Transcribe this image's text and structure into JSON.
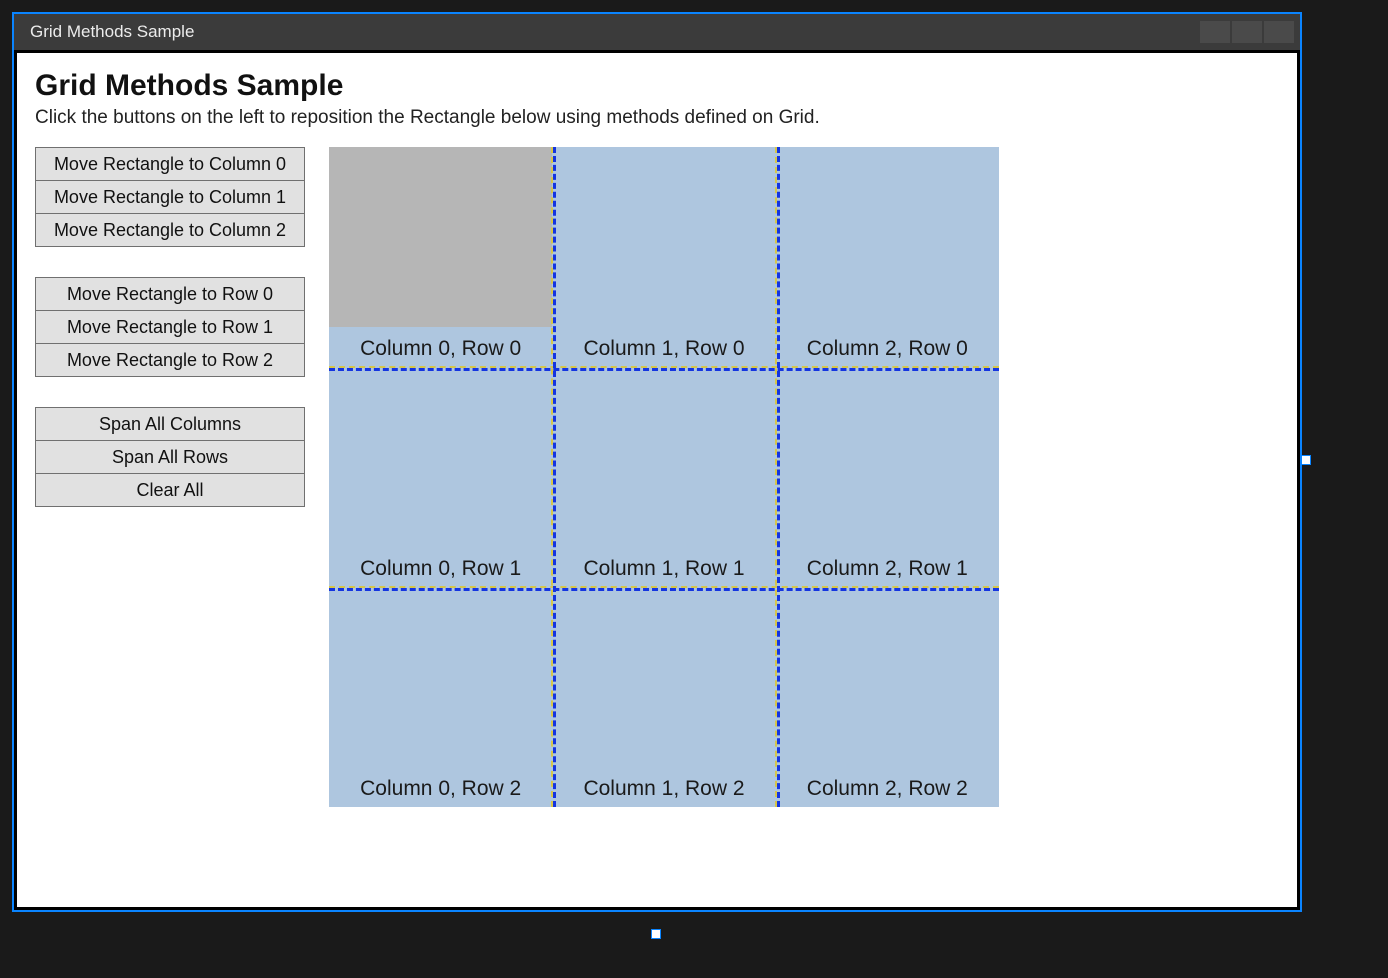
{
  "window": {
    "title": "Grid Methods Sample"
  },
  "header": {
    "title": "Grid Methods Sample",
    "subtitle": "Click the buttons on the left to reposition the Rectangle below using methods defined on Grid."
  },
  "buttonGroups": {
    "column": [
      "Move Rectangle to Column 0",
      "Move Rectangle to Column 1",
      "Move Rectangle to Column 2"
    ],
    "row": [
      "Move Rectangle to Row 0",
      "Move Rectangle to Row 1",
      "Move Rectangle to Row 2"
    ],
    "span": [
      "Span All Columns",
      "Span All Rows",
      "Clear All"
    ]
  },
  "grid": {
    "cells": [
      "Column 0, Row 0",
      "Column 1, Row 0",
      "Column 2, Row 0",
      "Column 0, Row 1",
      "Column 1, Row 1",
      "Column 2, Row 1",
      "Column 0, Row 2",
      "Column 1, Row 2",
      "Column 2, Row 2"
    ]
  }
}
